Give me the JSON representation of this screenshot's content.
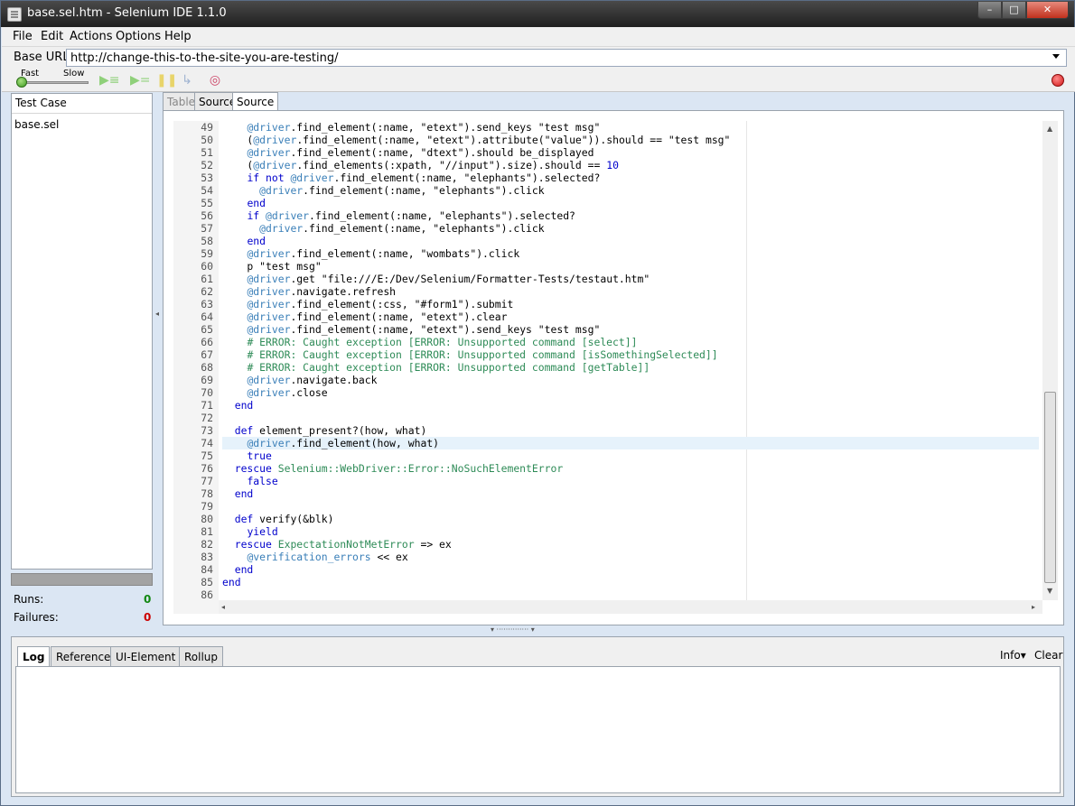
{
  "window": {
    "title": "base.sel.htm - Selenium IDE 1.1.0"
  },
  "window_controls": {
    "minimize": "–",
    "maximize": "□",
    "close": "✕"
  },
  "menu": [
    "File",
    "Edit",
    "Actions",
    "Options",
    "Help"
  ],
  "base_url": {
    "label": "Base URL",
    "value": "http://change-this-to-the-site-you-are-testing/"
  },
  "toolbar": {
    "fast": "Fast",
    "slow": "Slow"
  },
  "test_case": {
    "header": "Test Case",
    "items": [
      "base.sel"
    ]
  },
  "stats": {
    "runs_label": "Runs:",
    "runs": "0",
    "failures_label": "Failures:",
    "failures": "0"
  },
  "editor_tabs": [
    "Table",
    "Source",
    "Source"
  ],
  "code_lines": [
    {
      "n": "49",
      "t": "    @driver.find_element(:name, \"etext\").send_keys \"test msg\""
    },
    {
      "n": "50",
      "t": "    (@driver.find_element(:name, \"etext\").attribute(\"value\")).should == \"test msg\""
    },
    {
      "n": "51",
      "t": "    @driver.find_element(:name, \"dtext\").should be_displayed"
    },
    {
      "n": "52",
      "t": "    (@driver.find_elements(:xpath, \"//input\").size).should == 10"
    },
    {
      "n": "53",
      "t": "    if not @driver.find_element(:name, \"elephants\").selected?"
    },
    {
      "n": "54",
      "t": "      @driver.find_element(:name, \"elephants\").click"
    },
    {
      "n": "55",
      "t": "    end"
    },
    {
      "n": "56",
      "t": "    if @driver.find_element(:name, \"elephants\").selected?"
    },
    {
      "n": "57",
      "t": "      @driver.find_element(:name, \"elephants\").click"
    },
    {
      "n": "58",
      "t": "    end"
    },
    {
      "n": "59",
      "t": "    @driver.find_element(:name, \"wombats\").click"
    },
    {
      "n": "60",
      "t": "    p \"test msg\""
    },
    {
      "n": "61",
      "t": "    @driver.get \"file:///E:/Dev/Selenium/Formatter-Tests/testaut.htm\""
    },
    {
      "n": "62",
      "t": "    @driver.navigate.refresh"
    },
    {
      "n": "63",
      "t": "    @driver.find_element(:css, \"#form1\").submit"
    },
    {
      "n": "64",
      "t": "    @driver.find_element(:name, \"etext\").clear"
    },
    {
      "n": "65",
      "t": "    @driver.find_element(:name, \"etext\").send_keys \"test msg\""
    },
    {
      "n": "66",
      "t": "    # ERROR: Caught exception [ERROR: Unsupported command [select]]"
    },
    {
      "n": "67",
      "t": "    # ERROR: Caught exception [ERROR: Unsupported command [isSomethingSelected]]"
    },
    {
      "n": "68",
      "t": "    # ERROR: Caught exception [ERROR: Unsupported command [getTable]]"
    },
    {
      "n": "69",
      "t": "    @driver.navigate.back"
    },
    {
      "n": "70",
      "t": "    @driver.close"
    },
    {
      "n": "71",
      "t": "  end"
    },
    {
      "n": "72",
      "t": ""
    },
    {
      "n": "73",
      "t": "  def element_present?(how, what)"
    },
    {
      "n": "74",
      "t": "    @driver.find_element(how, what)"
    },
    {
      "n": "75",
      "t": "    true"
    },
    {
      "n": "76",
      "t": "  rescue Selenium::WebDriver::Error::NoSuchElementError"
    },
    {
      "n": "77",
      "t": "    false"
    },
    {
      "n": "78",
      "t": "  end"
    },
    {
      "n": "79",
      "t": ""
    },
    {
      "n": "80",
      "t": "  def verify(&blk)"
    },
    {
      "n": "81",
      "t": "    yield"
    },
    {
      "n": "82",
      "t": "  rescue ExpectationNotMetError => ex"
    },
    {
      "n": "83",
      "t": "    @verification_errors << ex"
    },
    {
      "n": "84",
      "t": "  end"
    },
    {
      "n": "85",
      "t": "end"
    },
    {
      "n": "86",
      "t": ""
    }
  ],
  "bottom_tabs": [
    "Log",
    "Reference",
    "UI-Element",
    "Rollup"
  ],
  "bottom_controls": {
    "info": "Info▾",
    "clear": "Clear"
  },
  "colors": {
    "keyword": "#0000cc",
    "ivar": "#3a7fb8",
    "comment": "#2e8b57",
    "number": "#0000cc",
    "failures": "#cc0000",
    "runs": "#118811"
  }
}
